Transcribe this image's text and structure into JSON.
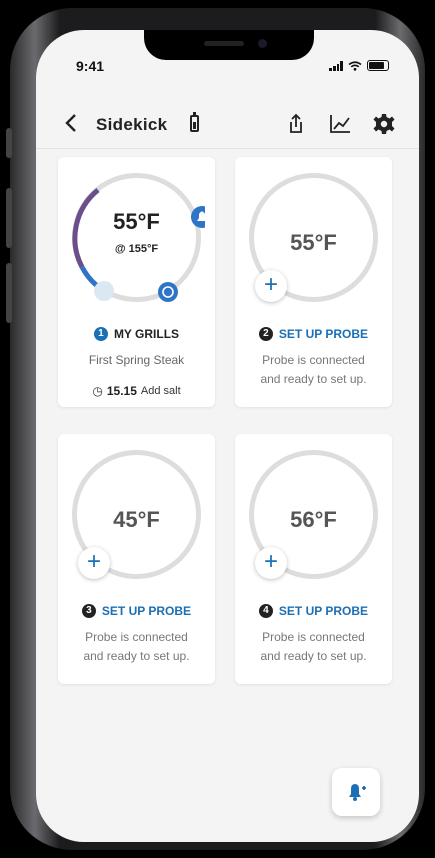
{
  "status": {
    "time": "9:41"
  },
  "header": {
    "title": "Sidekick",
    "icons": [
      "back-icon",
      "battery-icon",
      "share-icon",
      "chart-icon",
      "gear-icon"
    ]
  },
  "cards": [
    {
      "temp": "55°F",
      "target": "@ 155°F",
      "number": "1",
      "label": "MY GRILLS",
      "desc": "First Spring Steak",
      "timer": "15.15",
      "timer_note": "Add salt"
    },
    {
      "temp": "55°F",
      "number": "2",
      "link": "SET UP PROBE",
      "desc_line1": "Probe is connected",
      "desc_line2": "and ready to set up."
    },
    {
      "temp": "45°F",
      "number": "3",
      "link": "SET UP PROBE",
      "desc_line1": "Probe is connected",
      "desc_line2": "and ready to set up."
    },
    {
      "temp": "56°F",
      "number": "4",
      "link": "SET UP PROBE",
      "desc_line1": "Probe is connected",
      "desc_line2": "and ready to set up."
    }
  ],
  "colors": {
    "accent": "#1a6fb5",
    "ring": "#dddddd",
    "ring_active": "#2e75c8",
    "ring_warm": "#6b4f8a"
  },
  "fab": {
    "icon": "add-alert-icon"
  }
}
